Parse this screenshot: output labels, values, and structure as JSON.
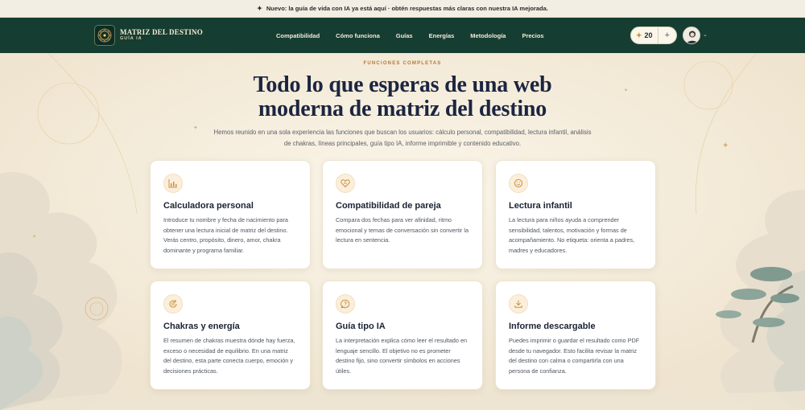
{
  "announcement": {
    "text": "Nuevo: la guía de vida con IA ya está aquí · obtén respuestas más claras con nuestra IA mejorada."
  },
  "nav": {
    "brand_name": "MATRIZ DEL DESTINO",
    "brand_sub": "GUÍA IA",
    "links": [
      "Compatibilidad",
      "Cómo funciona",
      "Guías",
      "Energías",
      "Metodología",
      "Precios"
    ],
    "credits": "20"
  },
  "hero": {
    "eyebrow": "FUNCIONES COMPLETAS",
    "title_line1": "Todo lo que esperas de una web",
    "title_line2": "moderna de matriz del destino",
    "lead": "Hemos reunido en una sola experiencia las funciones que buscan los usuarios: cálculo personal, compatibilidad, lectura infantil, análisis de chakras, líneas principales, guía tipo IA, informe imprimible y contenido educativo."
  },
  "cards": [
    {
      "icon": "bar-chart-icon",
      "title": "Calculadora personal",
      "desc": "Introduce tu nombre y fecha de nacimiento para obtener una lectura inicial de matriz del destino. Verás centro, propósito, dinero, amor, chakra dominante y programa familiar."
    },
    {
      "icon": "heart-icon",
      "title": "Compatibilidad de pareja",
      "desc": "Compara dos fechas para ver afinidad, ritmo emocional y temas de conversación sin convertir la lectura en sentencia."
    },
    {
      "icon": "smile-icon",
      "title": "Lectura infantil",
      "desc": "La lectura para niños ayuda a comprender sensibilidad, talentos, motivación y formas de acompañamiento. No etiqueta: orienta a padres, madres y educadores."
    },
    {
      "icon": "refresh-icon",
      "title": "Chakras y energía",
      "desc": "El resumen de chakras muestra dónde hay fuerza, exceso o necesidad de equilibrio. En una matriz del destino, esta parte conecta cuerpo, emoción y decisiones prácticas."
    },
    {
      "icon": "chat-question-icon",
      "title": "Guía tipo IA",
      "desc": "La interpretación explica cómo leer el resultado en lenguaje sencillo. El objetivo no es prometer destino fijo, sino convertir símbolos en acciones útiles."
    },
    {
      "icon": "download-icon",
      "title": "Informe descargable",
      "desc": "Puedes imprimir o guardar el resultado como PDF desde tu navegador. Esto facilita revisar la matriz del destino con calma o compartirla con una persona de confianza."
    }
  ],
  "colors": {
    "nav_bg": "#163d31",
    "accent": "#c9913d",
    "page_bg": "#f6efe2"
  }
}
